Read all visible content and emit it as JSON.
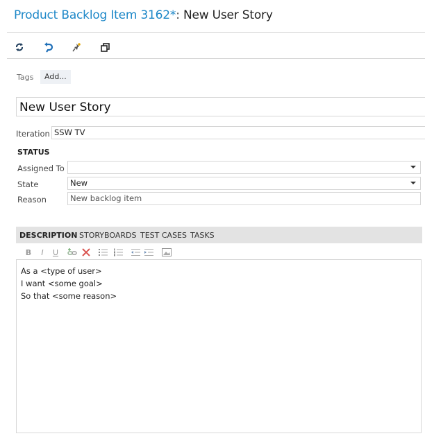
{
  "header": {
    "title_main": "Product Backlog Item 3162*",
    "title_sep": ": ",
    "title_sub": "New User Story"
  },
  "toolbar": {
    "refresh_icon": "refresh-icon",
    "undo_icon": "undo-icon",
    "pin_icon": "pin-icon",
    "copy_icon": "copy-icon"
  },
  "tags": {
    "label": "Tags",
    "add_label": "Add..."
  },
  "work_item": {
    "title_value": "New User Story",
    "iteration_label": "Iteration",
    "iteration_value": "SSW TV"
  },
  "status": {
    "header": "STATUS",
    "assigned_to_label": "Assigned To",
    "assigned_to_value": "",
    "state_label": "State",
    "state_value": "New",
    "reason_label": "Reason",
    "reason_value": "New backlog item"
  },
  "tabs": [
    {
      "label": "DESCRIPTION"
    },
    {
      "label": "STORYBOARDS"
    },
    {
      "label": "TEST CASES"
    },
    {
      "label": "TASKS"
    }
  ],
  "rich_text": {
    "bold": "B",
    "italic": "I",
    "underline": "U"
  },
  "description": {
    "line1": "As a <type of user>",
    "line2": "I want <some goal>",
    "line3": "So that <some reason>"
  },
  "colors": {
    "title_blue": "#1e88c8",
    "tabbar_bg": "#e3e3e3"
  }
}
